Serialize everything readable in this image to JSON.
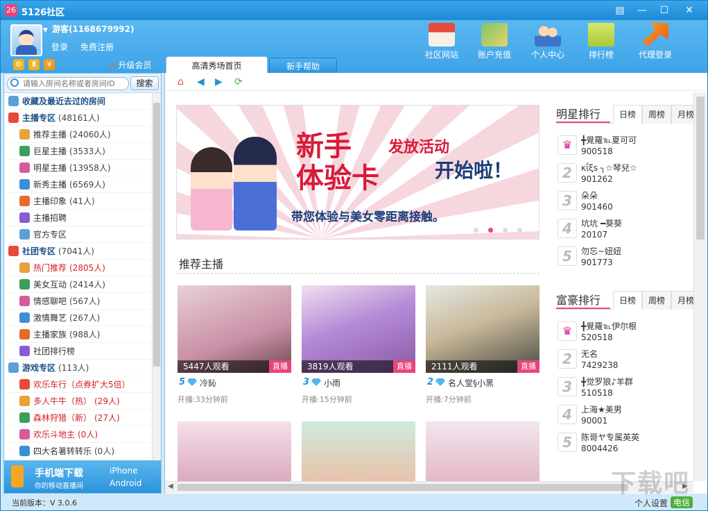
{
  "window": {
    "title": "5126社区",
    "logo_text": "26"
  },
  "user": {
    "name": "游客(1168679992)",
    "login": "登录",
    "register": "免费注册",
    "upgrade": "升级会员"
  },
  "topnav": [
    {
      "label": "社区网站",
      "icon": "house-icon"
    },
    {
      "label": "账户充值",
      "icon": "money-icon"
    },
    {
      "label": "个人中心",
      "icon": "users-icon"
    },
    {
      "label": "排行榜",
      "icon": "podium-icon"
    },
    {
      "label": "代理登录",
      "icon": "arrow-icon"
    }
  ],
  "tabs": [
    {
      "label": "高清秀场首页"
    },
    {
      "label": "新手帮助"
    }
  ],
  "search": {
    "placeholder": "请输入房间名称或者房间ID",
    "button": "搜索"
  },
  "tree": [
    {
      "type": "cat",
      "label": "收藏及最近去过的房间",
      "count": ""
    },
    {
      "type": "cat",
      "label": "主播专区",
      "count": "(48161人)"
    },
    {
      "type": "sub",
      "label": "推荐主播",
      "count": "(24060人)"
    },
    {
      "type": "sub",
      "label": "巨星主播",
      "count": "(3533人)"
    },
    {
      "type": "sub",
      "label": "明星主播",
      "count": "(13958人)"
    },
    {
      "type": "sub",
      "label": "新秀主播",
      "count": "(6569人)"
    },
    {
      "type": "sub",
      "label": "主播印象",
      "count": "(41人)"
    },
    {
      "type": "sub",
      "label": "主播招聘",
      "count": ""
    },
    {
      "type": "sub",
      "label": "官方专区",
      "count": ""
    },
    {
      "type": "cat",
      "label": "社团专区",
      "count": "(7041人)"
    },
    {
      "type": "red",
      "label": "热门推荐",
      "count": "(2805人)"
    },
    {
      "type": "sub",
      "label": "美女互动",
      "count": "(2414人)"
    },
    {
      "type": "sub",
      "label": "情感聊吧",
      "count": "(567人)"
    },
    {
      "type": "sub",
      "label": "激情舞艺",
      "count": "(267人)"
    },
    {
      "type": "sub",
      "label": "主播家族",
      "count": "(988人)"
    },
    {
      "type": "sub",
      "label": "社团排行榜",
      "count": ""
    },
    {
      "type": "cat",
      "label": "游戏专区",
      "count": "(113人)"
    },
    {
      "type": "red",
      "label": "欢乐车行（点券扩大5倍）",
      "count": ""
    },
    {
      "type": "red",
      "label": "多人牛牛（热）",
      "count": "(29人)"
    },
    {
      "type": "red",
      "label": "森林狩猎（新）",
      "count": "(27人)"
    },
    {
      "type": "red",
      "label": "欢乐斗地主",
      "count": "(0人)"
    },
    {
      "type": "sub",
      "label": "四大名著转转乐",
      "count": "(0人)"
    }
  ],
  "mobile": {
    "title": "手机端下载",
    "subtitle": "你的移动直播间",
    "iphone": "iPhone",
    "android": "Android"
  },
  "banner": {
    "line1": "新手",
    "line2": "体验卡",
    "tag1": "发放活动",
    "tag2": "开始啦！",
    "sub": "带您体验与美女零距离接触。"
  },
  "section_title": "推荐主播",
  "cards": [
    {
      "viewers": "5447人观看",
      "live": "直播",
      "level": "5",
      "name": "冷鈊",
      "time": "开播:33分钟前"
    },
    {
      "viewers": "3819人观看",
      "live": "直播",
      "level": "3",
      "name": "小雨",
      "time": "开播:15分钟前"
    },
    {
      "viewers": "2111人观看",
      "live": "直播",
      "level": "2",
      "name": "名人堂§小黑",
      "time": "开播:7分钟前"
    }
  ],
  "star_rank": {
    "title": "明星排行",
    "tabs": [
      "日榜",
      "周榜",
      "月榜"
    ],
    "items": [
      {
        "no": "1",
        "name": "╋覺羅℡夏可可",
        "id": "900518"
      },
      {
        "no": "2",
        "name": "κΐξs ╮☆琴兒☆",
        "id": "901262"
      },
      {
        "no": "3",
        "name": "朵朵",
        "id": "901460"
      },
      {
        "no": "4",
        "name": "坑坑 ━葵葵",
        "id": "20107"
      },
      {
        "no": "5",
        "name": "勿忘~妞妞",
        "id": "901773"
      }
    ]
  },
  "rich_rank": {
    "title": "富豪排行",
    "tabs": [
      "日榜",
      "周榜",
      "月榜"
    ],
    "items": [
      {
        "no": "1",
        "name": "╋覺羅℡伊尔根",
        "id": "520518"
      },
      {
        "no": "2",
        "name": "无名",
        "id": "7429238"
      },
      {
        "no": "3",
        "name": "╋觉罗狼♪羊群",
        "id": "510518"
      },
      {
        "no": "4",
        "name": "上海★美男",
        "id": "90001"
      },
      {
        "no": "5",
        "name": "陈哥ヤ专属英英",
        "id": "8004426"
      }
    ]
  },
  "status": {
    "version": "当前版本：V 3.0.6",
    "settings": "个人设置",
    "tel": "电信"
  },
  "watermark": "下载吧",
  "colors": {
    "accent": "#e8457a",
    "primary": "#2c93dc"
  }
}
